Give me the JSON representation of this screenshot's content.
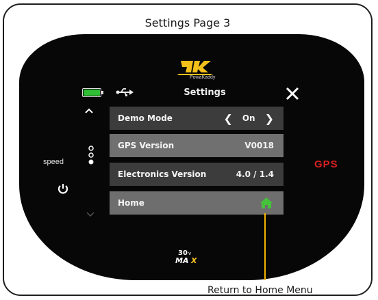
{
  "page": {
    "title": "Settings Page 3"
  },
  "device": {
    "brand": "PowaKaddy",
    "speed_label": "speed",
    "gps_label": "GPS",
    "model_badge": "30v MAX",
    "battery_color": "#2fbe34"
  },
  "screen": {
    "title": "Settings",
    "rows": [
      {
        "label": "Demo Mode",
        "value": "On"
      },
      {
        "label": "GPS Version",
        "value": "V0018"
      },
      {
        "label": "Electronics Version",
        "value": "4.0 / 1.4"
      },
      {
        "label": "Home",
        "icon": "house-icon"
      }
    ]
  },
  "annotation": {
    "label": "Return to Home Menu",
    "color": "#f5b400"
  }
}
